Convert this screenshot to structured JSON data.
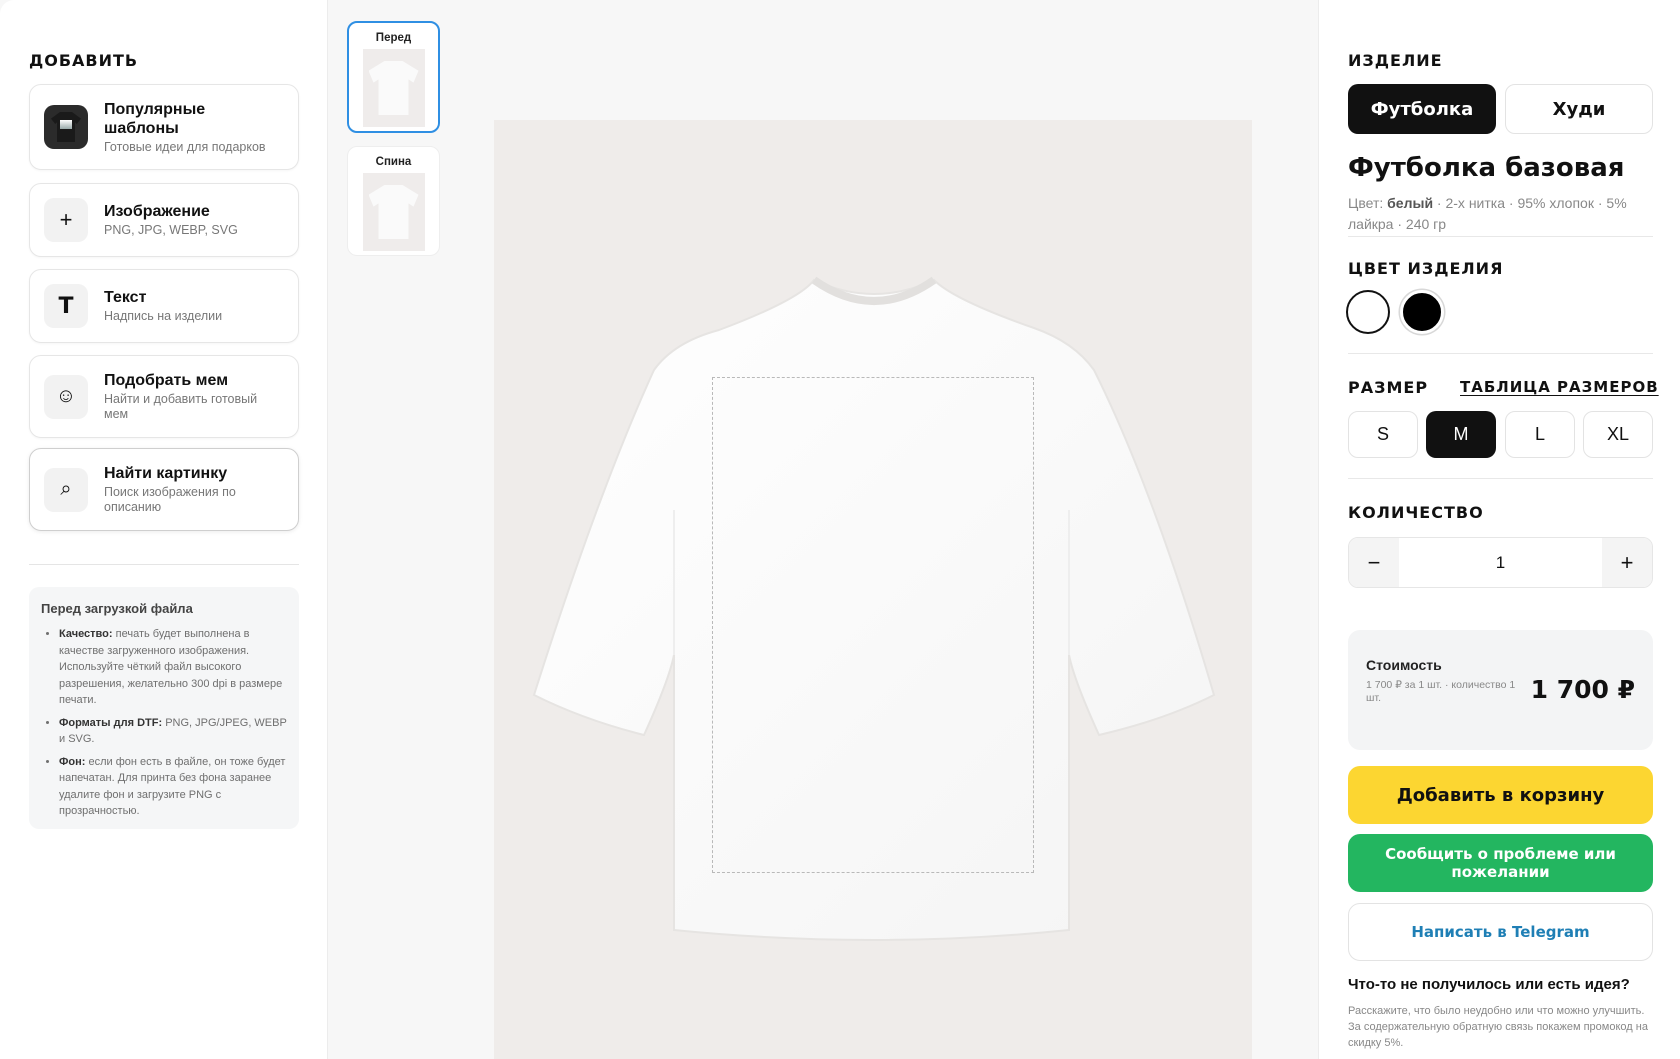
{
  "left": {
    "title": "ДОБАВИТЬ",
    "cards": [
      {
        "title": "Популярные шаблоны",
        "sub": "Готовые идеи для подарков",
        "icon": "shirt-template-thumbnail"
      },
      {
        "title": "Изображение",
        "sub": "PNG, JPG, WEBP, SVG",
        "icon": "plus-icon",
        "glyph": "+"
      },
      {
        "title": "Текст",
        "sub": "Надпись на изделии",
        "icon": "text-icon",
        "glyph": "T"
      },
      {
        "title": "Подобрать мем",
        "sub": "Найти и добавить готовый мем",
        "icon": "smiley-icon",
        "glyph": "☺"
      },
      {
        "title": "Найти картинку",
        "sub": "Поиск изображения по описанию",
        "icon": "search-icon",
        "glyph": "⌕"
      }
    ],
    "info": {
      "title": "Перед загрузкой файла",
      "items": [
        {
          "label": "Качество:",
          "text": "печать будет выполнена в качестве загруженного изображения. Используйте чёткий файл высокого разрешения, желательно 300 dpi в размере печати."
        },
        {
          "label": "Форматы для DTF:",
          "text": "PNG, JPG/JPEG, WEBP и SVG."
        },
        {
          "label": "Фон:",
          "text": "если фон есть в файле, он тоже будет напечатан. Для принта без фона заранее удалите фон и загрузите PNG с прозрачностью."
        }
      ]
    }
  },
  "views": [
    {
      "label": "Перед",
      "active": true
    },
    {
      "label": "Спина",
      "active": false
    }
  ],
  "right": {
    "product_section": "ИЗДЕЛИЕ",
    "product_types": [
      "Футболка",
      "Худи"
    ],
    "product_title": "Футболка базовая",
    "desc": {
      "color_label": "Цвет:",
      "color_value": "белый",
      "rest": " · 2-х нитка · 95% хлопок · 5% лайкра · 240 гр"
    },
    "color_section": "ЦВЕТ ИЗДЕЛИЯ",
    "colors": [
      {
        "name": "white",
        "hex": "#ffffff"
      },
      {
        "name": "black",
        "hex": "#000000"
      }
    ],
    "size_section": "РАЗМЕР",
    "size_table_link": "ТАБЛИЦА РАЗМЕРОВ",
    "sizes": [
      "S",
      "M",
      "L",
      "XL"
    ],
    "selected_size": "M",
    "qty_section": "КОЛИЧЕСТВО",
    "qty": {
      "minus": "−",
      "value": "1",
      "plus": "+"
    },
    "price": {
      "label": "Стоимость",
      "sub": "1 700 ₽ за 1 шт. · количество 1 шт.",
      "value": "1 700 ₽"
    },
    "add_to_cart": "Добавить в корзину",
    "report": "Сообщить о проблеме или пожелании",
    "telegram": "Написать в Telegram",
    "feedback_title": "Что-то не получилось или есть идея?",
    "feedback_text": "Расскажите, что было неудобно или что можно улучшить. За содержательную обратную связь покажем промокод на скидку 5%."
  },
  "colors": {
    "accent_blue": "#2f8fe3",
    "cta_yellow": "#fcd631",
    "cta_green": "#23b660",
    "telegram_blue": "#1f7fb5"
  }
}
